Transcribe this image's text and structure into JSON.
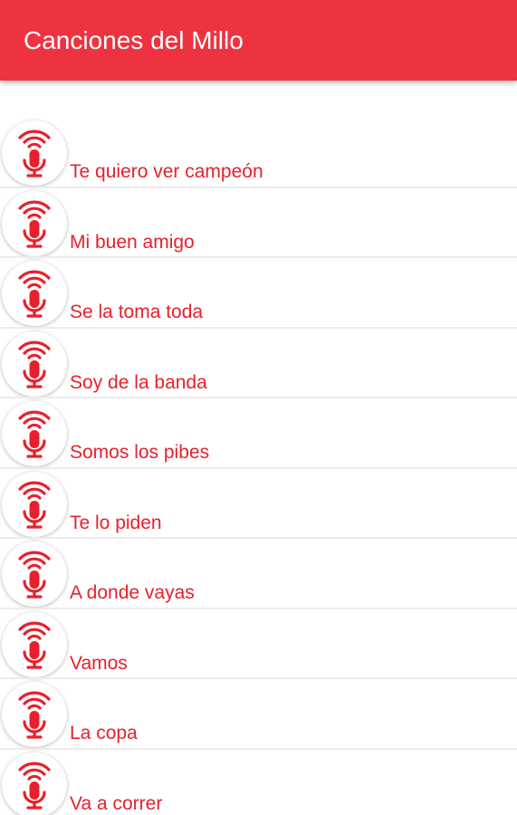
{
  "app_bar": {
    "title": "Canciones del Millo"
  },
  "colors": {
    "app_bar_background": "#ee3340",
    "accent_red": "#e8202c",
    "divider": "#ececec"
  },
  "songs": [
    {
      "label": "Te quiero ver campeón",
      "icon": "microphone-icon"
    },
    {
      "label": "Mi buen amigo",
      "icon": "microphone-icon"
    },
    {
      "label": "Se la toma toda",
      "icon": "microphone-icon"
    },
    {
      "label": "Soy de la banda",
      "icon": "microphone-icon"
    },
    {
      "label": "Somos los pibes",
      "icon": "microphone-icon"
    },
    {
      "label": "Te lo piden",
      "icon": "microphone-icon"
    },
    {
      "label": "A donde vayas",
      "icon": "microphone-icon"
    },
    {
      "label": "Vamos",
      "icon": "microphone-icon"
    },
    {
      "label": "La copa",
      "icon": "microphone-icon"
    },
    {
      "label": "Va a correr",
      "icon": "microphone-icon"
    }
  ]
}
